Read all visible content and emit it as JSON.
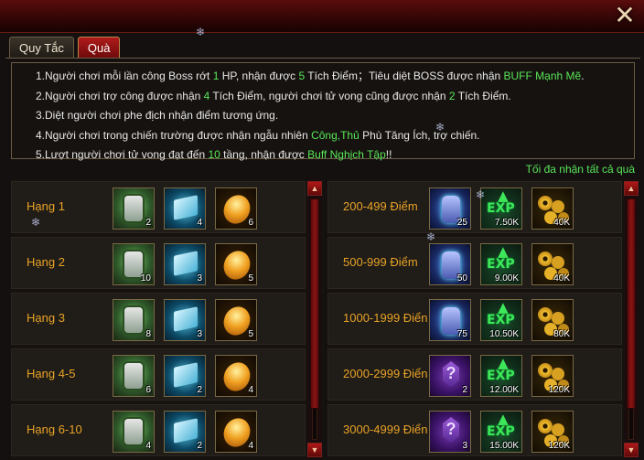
{
  "tabs": [
    {
      "label": "Quy Tắc"
    },
    {
      "label": "Quà"
    }
  ],
  "rules": [
    [
      {
        "t": "1.Người chơi mỗi lần công Boss rớt "
      },
      {
        "t": "1",
        "g": true
      },
      {
        "t": " HP, nhận được "
      },
      {
        "t": "5",
        "g": true
      },
      {
        "t": " Tích Điểm；Tiêu diệt BOSS được nhận "
      },
      {
        "t": "BUFF Mạnh Mẽ",
        "g": true
      },
      {
        "t": "."
      }
    ],
    [
      {
        "t": "2.Người chơi trợ công được nhận "
      },
      {
        "t": "4",
        "g": true
      },
      {
        "t": " Tích Điểm, người chơi tử vong cũng được nhận "
      },
      {
        "t": "2",
        "g": true
      },
      {
        "t": " Tích Điểm."
      }
    ],
    [
      {
        "t": "3.Diệt người chơi phe địch nhận điểm tương ứng."
      }
    ],
    [
      {
        "t": "4.Người chơi trong chiến trường được nhận ngẫu nhiên "
      },
      {
        "t": "Công,Thủ",
        "g": true
      },
      {
        "t": " Phù Tăng Ích, trợ chiến."
      }
    ],
    [
      {
        "t": "5.Lượt người chơi tử vong đạt đến "
      },
      {
        "t": "10",
        "g": true
      },
      {
        "t": " tầng, nhận được "
      },
      {
        "t": "Buff Nghịch Tập",
        "g": true
      },
      {
        "t": "!!"
      }
    ]
  ],
  "max_all_label": "Tối đa nhận tất cả quà",
  "rank_rewards": [
    {
      "label": "Hạng 1",
      "items": [
        {
          "icon": "armor-icon",
          "qty": "2"
        },
        {
          "icon": "skill-book-icon",
          "qty": "4"
        },
        {
          "icon": "gold-gem-icon",
          "qty": "6"
        }
      ]
    },
    {
      "label": "Hạng 2",
      "items": [
        {
          "icon": "armor-icon",
          "qty": "10"
        },
        {
          "icon": "skill-book-icon",
          "qty": "3"
        },
        {
          "icon": "gold-gem-icon",
          "qty": "5"
        }
      ]
    },
    {
      "label": "Hạng 3",
      "items": [
        {
          "icon": "armor-icon",
          "qty": "8"
        },
        {
          "icon": "skill-book-icon",
          "qty": "3"
        },
        {
          "icon": "gold-gem-icon",
          "qty": "5"
        }
      ]
    },
    {
      "label": "Hạng 4-5",
      "items": [
        {
          "icon": "armor-icon",
          "qty": "6"
        },
        {
          "icon": "skill-book-icon",
          "qty": "2"
        },
        {
          "icon": "gold-gem-icon",
          "qty": "4"
        }
      ]
    },
    {
      "label": "Hạng 6-10",
      "items": [
        {
          "icon": "armor-icon",
          "qty": "4"
        },
        {
          "icon": "skill-book-icon",
          "qty": "2"
        },
        {
          "icon": "gold-gem-icon",
          "qty": "4"
        }
      ]
    }
  ],
  "point_rewards": [
    {
      "label": "200-499 Điểm",
      "items": [
        {
          "icon": "rune-icon",
          "qty": "25"
        },
        {
          "icon": "exp-icon",
          "qty": "7.50K"
        },
        {
          "icon": "coins-icon",
          "qty": "40K"
        }
      ]
    },
    {
      "label": "500-999 Điểm",
      "items": [
        {
          "icon": "rune-icon",
          "qty": "50"
        },
        {
          "icon": "exp-icon",
          "qty": "9.00K"
        },
        {
          "icon": "coins-icon",
          "qty": "40K"
        }
      ]
    },
    {
      "label": "1000-1999 Điển",
      "items": [
        {
          "icon": "rune-icon",
          "qty": "75"
        },
        {
          "icon": "exp-icon",
          "qty": "10.50K"
        },
        {
          "icon": "coins-icon",
          "qty": "80K"
        }
      ]
    },
    {
      "label": "2000-2999 Điển",
      "items": [
        {
          "icon": "mystery-box-icon",
          "qty": "2"
        },
        {
          "icon": "exp-icon",
          "qty": "12.00K"
        },
        {
          "icon": "coins-icon",
          "qty": "120K"
        }
      ]
    },
    {
      "label": "3000-4999 Điển",
      "items": [
        {
          "icon": "mystery-box-icon",
          "qty": "3"
        },
        {
          "icon": "exp-icon",
          "qty": "15.00K"
        },
        {
          "icon": "coins-icon",
          "qty": "120K"
        }
      ]
    }
  ],
  "close_glyph": "✕"
}
